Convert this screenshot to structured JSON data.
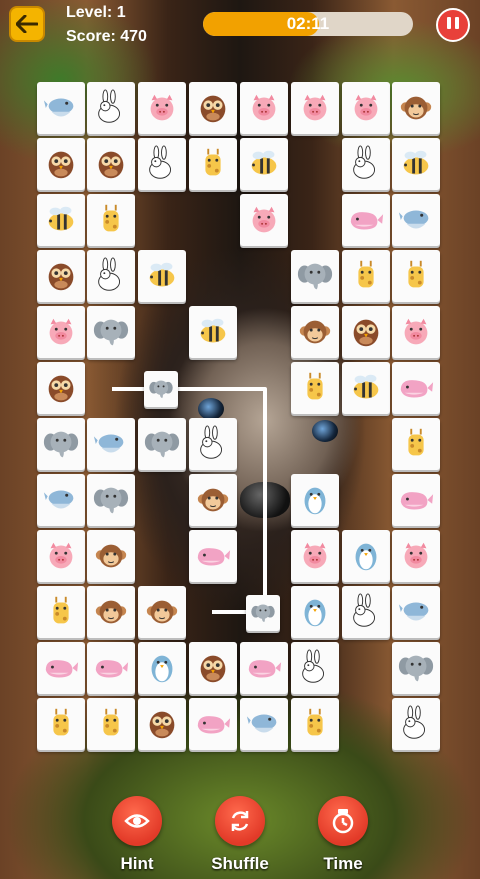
{
  "header": {
    "level_label": "Level: 1",
    "score_label": "Score: 470",
    "timer_text": "02:11",
    "timer_fraction": 0.55
  },
  "colors": {
    "accent": "#f2a100",
    "button_red": "#e23a28",
    "back_button": "#f4b400"
  },
  "tiles": [
    [
      "dolphin",
      "rabbit",
      "pig",
      "owl",
      "pig",
      "pig",
      "pig",
      "monkey"
    ],
    [
      "owl",
      "owl",
      "rabbit",
      "giraffe",
      "bee",
      "",
      "rabbit",
      "bee"
    ],
    [
      "bee",
      "giraffe",
      "",
      "",
      "pig",
      "",
      "whale",
      "dolphin"
    ],
    [
      "owl",
      "rabbit",
      "bee",
      "",
      "",
      "elephant",
      "giraffe",
      "giraffe"
    ],
    [
      "pig",
      "elephant",
      "",
      "bee",
      "",
      "monkey",
      "owl",
      "pig"
    ],
    [
      "owl",
      "elephant_small",
      "",
      "",
      "",
      "giraffe",
      "bee",
      "whale"
    ],
    [
      "elephant",
      "dolphin",
      "elephant",
      "rabbit",
      "",
      "",
      "",
      "giraffe"
    ],
    [
      "dolphin",
      "elephant",
      "",
      "monkey",
      "",
      "penguin",
      "",
      "whale"
    ],
    [
      "pig",
      "monkey",
      "",
      "whale",
      "",
      "pig",
      "penguin",
      "pig"
    ],
    [
      "giraffe",
      "monkey",
      "monkey",
      "elephant_small",
      "",
      "penguin",
      "rabbit",
      "dolphin"
    ],
    [
      "whale",
      "whale",
      "penguin",
      "owl",
      "whale",
      "rabbit",
      "",
      "elephant"
    ],
    [
      "giraffe",
      "giraffe",
      "owl",
      "whale",
      "dolphin",
      "giraffe",
      "",
      "rabbit"
    ]
  ],
  "bottom_buttons": [
    {
      "label": "Hint",
      "icon": "eye-icon"
    },
    {
      "label": "Shuffle",
      "icon": "shuffle-icon"
    },
    {
      "label": "Time",
      "icon": "stopwatch-icon"
    }
  ]
}
